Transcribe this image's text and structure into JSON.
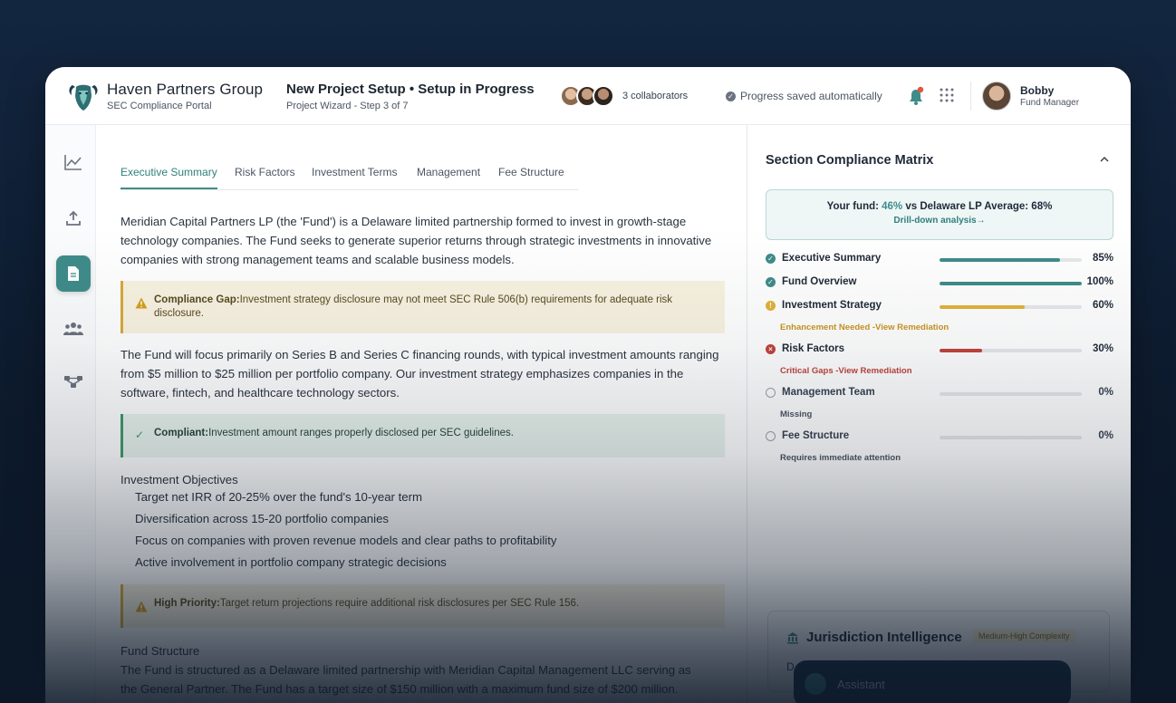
{
  "header": {
    "org_name": "Haven Partners Group",
    "org_subtitle": "SEC Compliance Portal",
    "project_title": "New Project Setup • Setup in Progress",
    "project_subtitle": "Project Wizard - Step 3 of 7",
    "collaborators": "3 collaborators",
    "save_status": "Progress saved automatically",
    "user_name": "Bobby",
    "user_role": "Fund Manager"
  },
  "sidebar": {
    "items": [
      {
        "icon": "chart-line-icon"
      },
      {
        "icon": "upload-icon"
      },
      {
        "icon": "document-icon",
        "active": true
      },
      {
        "icon": "users-icon"
      },
      {
        "icon": "workflow-icon"
      }
    ]
  },
  "tabs": [
    "Executive Summary",
    "Risk Factors",
    "Investment Terms",
    "Management",
    "Fee Structure"
  ],
  "editor": {
    "intro": "Meridian Capital Partners LP (the 'Fund') is a Delaware limited partnership formed to invest in growth-stage technology companies. The Fund seeks to generate superior returns through strategic investments in innovative companies with strong management teams and scalable business models.",
    "gap_label": "Compliance Gap:",
    "gap_text": "Investment strategy disclosure may not meet SEC Rule 506(b) requirements for adequate risk disclosure.",
    "focus": "The Fund will focus primarily on Series B and Series C financing rounds, with typical investment amounts ranging from $5 million to $25 million per portfolio company. Our investment strategy emphasizes companies in the software, fintech, and healthcare technology sectors.",
    "compliant_label": "Compliant:",
    "compliant_text": "Investment amount ranges properly disclosed per SEC guidelines.",
    "objectives_heading": "Investment Objectives",
    "objectives": [
      "Target net IRR of 20-25% over the fund's 10-year term",
      "Diversification across 15-20 portfolio companies",
      "Focus on companies with proven revenue models and clear paths to profitability",
      "Active involvement in portfolio company strategic decisions"
    ],
    "priority_label": "High Priority:",
    "priority_text": "Target return projections require additional risk disclosures per SEC Rule 156.",
    "structure_heading": "Fund Structure",
    "structure_line1": "The Fund is structured as a Delaware limited partnership with Meridian Capital Management LLC serving as",
    "structure_line2": "the General Partner. The Fund has a target size of $150 million with a maximum fund size of $200 million."
  },
  "panel": {
    "title": "Section Compliance Matrix",
    "bench_prefix": "Your fund: ",
    "bench_value": "46%",
    "bench_suffix": " vs Delaware LP Average: 68%",
    "bench_link": "Drill-down analysis→",
    "sections": [
      {
        "name": "Executive Summary",
        "pct_label": "85%",
        "progress": 0.85,
        "status": "complete",
        "color": "#3f8c8a",
        "note": ""
      },
      {
        "name": "Fund Overview",
        "pct_label": "100%",
        "progress": 1.0,
        "status": "complete",
        "color": "#3f8c8a",
        "note": ""
      },
      {
        "name": "Investment Strategy",
        "pct_label": "60%",
        "progress": 0.6,
        "status": "warning",
        "color": "#e2b23a",
        "note": "Enhancement Needed -View Remediation"
      },
      {
        "name": "Risk Factors",
        "pct_label": "30%",
        "progress": 0.3,
        "status": "critical",
        "color": "#c0443b",
        "note": "Critical Gaps -View Remediation"
      },
      {
        "name": "Management Team",
        "pct_label": "0%",
        "progress": 0,
        "status": "empty",
        "color": "#9ca3af",
        "note": "Missing"
      },
      {
        "name": "Fee Structure",
        "pct_label": "0%",
        "progress": 0,
        "status": "empty",
        "color": "#9ca3af",
        "note": "Requires immediate attention"
      }
    ],
    "jurisdiction_title": "Jurisdiction Intelligence",
    "jurisdiction_badge": "Medium-High Complexity",
    "jurisdiction_partial": "D",
    "assistant_label": "Assistant"
  },
  "colors": {
    "accent": "#3f8c8a",
    "warning": "#e2b23a",
    "critical": "#c0443b"
  }
}
